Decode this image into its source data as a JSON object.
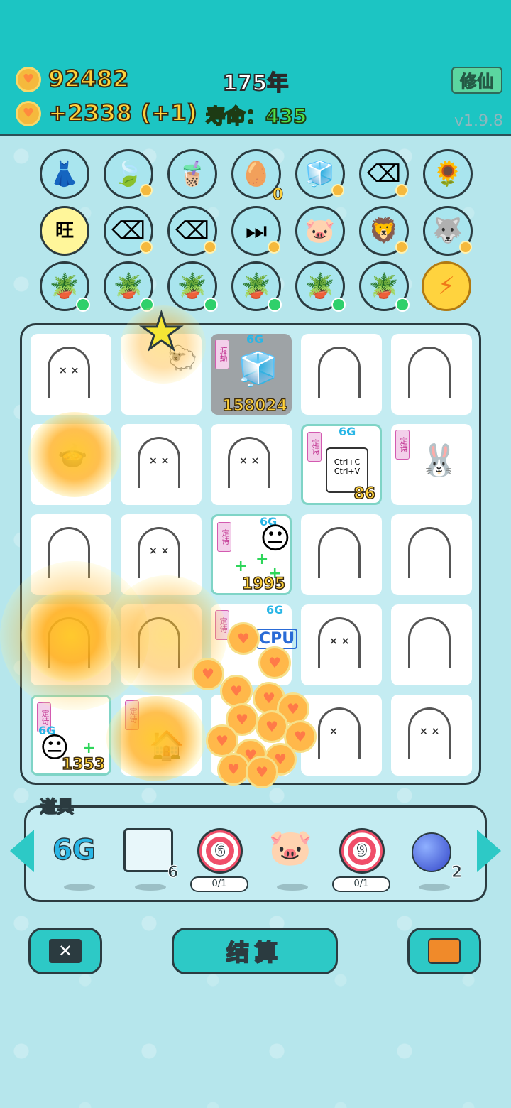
{
  "header": {
    "coins": "92482",
    "income": "+2338 (+1)",
    "year": "175年",
    "lifespan": "寿命：435",
    "cultivate_button": "修仙",
    "version": "v1.9.8"
  },
  "circle_rows": {
    "row1_badge": "0"
  },
  "board": {
    "fridge_value": "158024",
    "fridge_tag": "6G",
    "fridge_side": "渡劫",
    "copy_value": "86",
    "copy_tag": "6G",
    "copy_side": "定诗",
    "copy_line1": "Ctrl+C",
    "copy_line2": "Ctrl+V",
    "face_value": "1995",
    "face_tag": "6G",
    "face_side": "定诗",
    "cpu_tag": "6G",
    "cpu_label": "CPU",
    "cpu_side": "定诗",
    "bottom_face_value": "1353",
    "bottom_face_tag": "6G",
    "bottom_face_side": "定诗",
    "bottom_side2": "定诗",
    "house_side": "定诗"
  },
  "items_panel": {
    "title": "道具",
    "items": [
      {
        "label": "6G"
      },
      {
        "count": "6"
      },
      {
        "target": "6",
        "progress": "0/1"
      },
      {
        "label": "piggy"
      },
      {
        "target": "9",
        "progress": "0/1"
      },
      {
        "count": "2"
      }
    ]
  },
  "buttons": {
    "settle": "结算"
  }
}
